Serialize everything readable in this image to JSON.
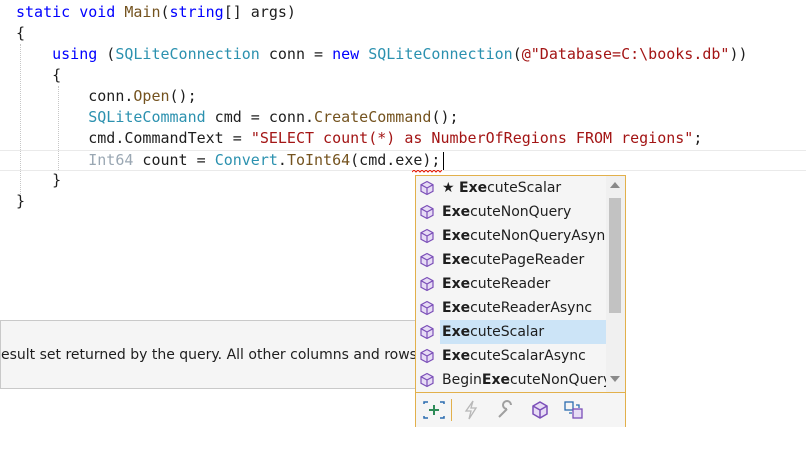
{
  "editor": {
    "lines": [
      {
        "tokens": [
          {
            "t": "static void ",
            "c": "kw"
          },
          {
            "t": "Main",
            "c": "mt"
          },
          {
            "t": "(",
            "c": ""
          },
          {
            "t": "string",
            "c": "kw"
          },
          {
            "t": "[] args)",
            "c": ""
          }
        ]
      },
      {
        "tokens": [
          {
            "t": "{",
            "c": ""
          }
        ]
      },
      {
        "tokens": [
          {
            "t": "    ",
            "c": ""
          },
          {
            "t": "using",
            "c": "kw"
          },
          {
            "t": " (",
            "c": ""
          },
          {
            "t": "SQLiteConnection",
            "c": "ty"
          },
          {
            "t": " conn = ",
            "c": ""
          },
          {
            "t": "new",
            "c": "kw"
          },
          {
            "t": " ",
            "c": ""
          },
          {
            "t": "SQLiteConnection",
            "c": "ty"
          },
          {
            "t": "(",
            "c": ""
          },
          {
            "t": "@\"Database=C:\\books.db\"",
            "c": "st"
          },
          {
            "t": "))",
            "c": ""
          }
        ]
      },
      {
        "tokens": [
          {
            "t": "    {",
            "c": ""
          }
        ]
      },
      {
        "tokens": [
          {
            "t": "        conn.",
            "c": ""
          },
          {
            "t": "Open",
            "c": "mt"
          },
          {
            "t": "();",
            "c": ""
          }
        ]
      },
      {
        "tokens": [
          {
            "t": "        ",
            "c": ""
          },
          {
            "t": "SQLiteCommand",
            "c": "ty"
          },
          {
            "t": " cmd = conn.",
            "c": ""
          },
          {
            "t": "CreateCommand",
            "c": "mt"
          },
          {
            "t": "();",
            "c": ""
          }
        ]
      },
      {
        "tokens": [
          {
            "t": "        cmd.CommandText = ",
            "c": ""
          },
          {
            "t": "\"SELECT count(*) as NumberOfRegions FROM regions\"",
            "c": "st"
          },
          {
            "t": ";",
            "c": ""
          }
        ]
      },
      {
        "tokens": [
          {
            "t": "        ",
            "c": ""
          },
          {
            "t": "Int64",
            "c": "gr"
          },
          {
            "t": " count = ",
            "c": ""
          },
          {
            "t": "Convert",
            "c": "ty"
          },
          {
            "t": ".",
            "c": ""
          },
          {
            "t": "ToInt64",
            "c": "mt"
          },
          {
            "t": "(cmd.exe);",
            "c": ""
          }
        ]
      },
      {
        "tokens": [
          {
            "t": "    }",
            "c": ""
          }
        ]
      },
      {
        "tokens": [
          {
            "t": "}",
            "c": ""
          }
        ]
      }
    ]
  },
  "quickinfo": {
    "text": "esult set returned by the query. All other columns and rows are"
  },
  "completion": {
    "typed_prefix": "Exe",
    "selected_index": 6,
    "items": [
      {
        "star": "★ ",
        "pre": "",
        "match": "Exe",
        "post": "cuteScalar",
        "icon": "method-cube-icon"
      },
      {
        "star": "",
        "pre": "",
        "match": "Exe",
        "post": "cuteNonQuery",
        "icon": "method-cube-icon"
      },
      {
        "star": "",
        "pre": "",
        "match": "Exe",
        "post": "cuteNonQueryAsync",
        "icon": "method-cube-icon"
      },
      {
        "star": "",
        "pre": "",
        "match": "Exe",
        "post": "cutePageReader",
        "icon": "method-cube-icon"
      },
      {
        "star": "",
        "pre": "",
        "match": "Exe",
        "post": "cuteReader",
        "icon": "method-cube-icon"
      },
      {
        "star": "",
        "pre": "",
        "match": "Exe",
        "post": "cuteReaderAsync",
        "icon": "method-cube-icon"
      },
      {
        "star": "",
        "pre": "",
        "match": "Exe",
        "post": "cuteScalar",
        "icon": "method-cube-icon"
      },
      {
        "star": "",
        "pre": "",
        "match": "Exe",
        "post": "cuteScalarAsync",
        "icon": "method-cube-icon"
      },
      {
        "star": "",
        "pre": "Begin",
        "match": "Exe",
        "post": "cuteNonQuery",
        "icon": "method-cube-icon"
      }
    ],
    "filters": [
      "expand-filter-icon",
      "event-filter-icon",
      "property-wrench-filter-icon",
      "method-filter-icon",
      "extension-method-filter-icon"
    ]
  },
  "colors": {
    "keyword": "#0000ff",
    "type": "#2b91af",
    "method": "#74531f",
    "string": "#a31515",
    "selection": "#cce4f7",
    "popup_border": "#e2b04b",
    "method_icon": "#7b4fb8"
  }
}
